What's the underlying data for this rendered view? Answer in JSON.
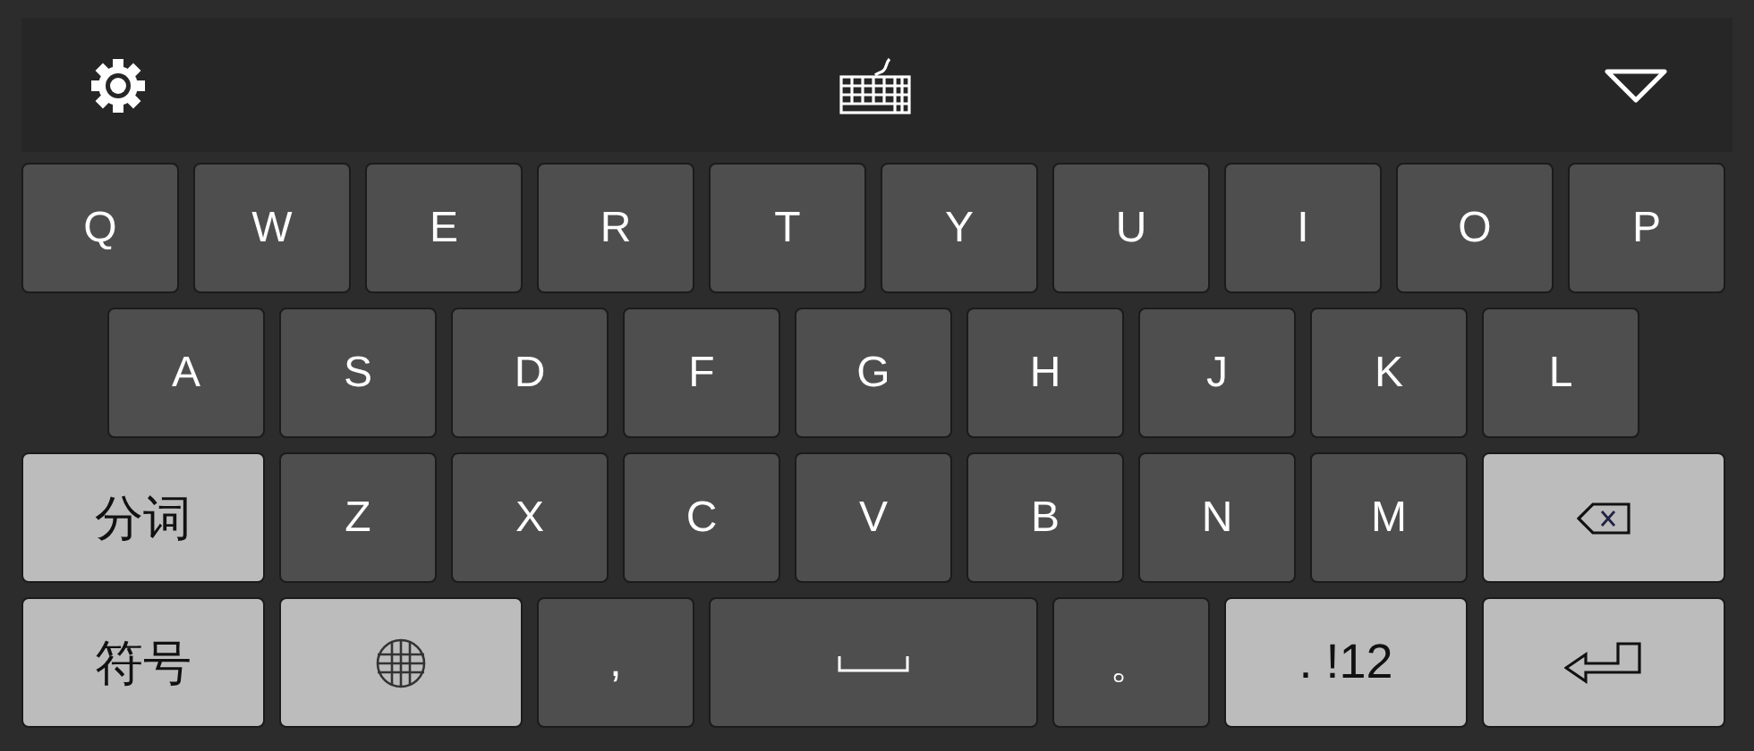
{
  "toolbar": {
    "items": [
      {
        "kind": "settings"
      },
      {
        "kind": "keyboard"
      },
      {
        "kind": "collapse"
      }
    ]
  },
  "rows": [
    [
      {
        "kind": "char",
        "label": "Q"
      },
      {
        "kind": "char",
        "label": "W"
      },
      {
        "kind": "char",
        "label": "E"
      },
      {
        "kind": "char",
        "label": "R"
      },
      {
        "kind": "char",
        "label": "T"
      },
      {
        "kind": "char",
        "label": "Y"
      },
      {
        "kind": "char",
        "label": "U"
      },
      {
        "kind": "char",
        "label": "I"
      },
      {
        "kind": "char",
        "label": "O"
      },
      {
        "kind": "char",
        "label": "P"
      }
    ],
    [
      {
        "kind": "char",
        "label": "A"
      },
      {
        "kind": "char",
        "label": "S"
      },
      {
        "kind": "char",
        "label": "D"
      },
      {
        "kind": "char",
        "label": "F"
      },
      {
        "kind": "char",
        "label": "G"
      },
      {
        "kind": "char",
        "label": "H"
      },
      {
        "kind": "char",
        "label": "J"
      },
      {
        "kind": "char",
        "label": "K"
      },
      {
        "kind": "char",
        "label": "L"
      }
    ],
    [
      {
        "kind": "function",
        "label": "分词"
      },
      {
        "kind": "char",
        "label": "Z"
      },
      {
        "kind": "char",
        "label": "X"
      },
      {
        "kind": "char",
        "label": "C"
      },
      {
        "kind": "char",
        "label": "V"
      },
      {
        "kind": "char",
        "label": "B"
      },
      {
        "kind": "char",
        "label": "N"
      },
      {
        "kind": "char",
        "label": "M"
      },
      {
        "kind": "backspace"
      }
    ],
    [
      {
        "kind": "function",
        "label": "符号"
      },
      {
        "kind": "globe"
      },
      {
        "kind": "char",
        "label": ","
      },
      {
        "kind": "space"
      },
      {
        "kind": "char",
        "label": "。"
      },
      {
        "kind": "function",
        "label": ". !12"
      },
      {
        "kind": "enter"
      }
    ]
  ]
}
